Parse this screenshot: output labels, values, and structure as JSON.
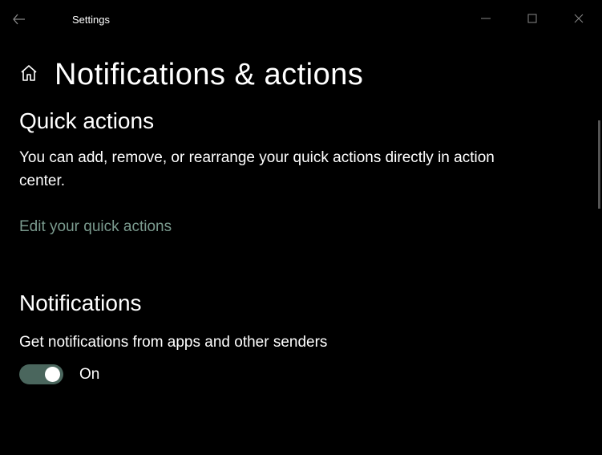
{
  "titlebar": {
    "title": "Settings"
  },
  "header": {
    "page_title": "Notifications & actions"
  },
  "quick_actions": {
    "heading": "Quick actions",
    "description": "You can add, remove, or rearrange your quick actions directly in action center.",
    "link_label": "Edit your quick actions"
  },
  "notifications": {
    "heading": "Notifications",
    "toggle_label": "Get notifications from apps and other senders",
    "toggle_on": true,
    "toggle_status": "On"
  },
  "colors": {
    "accent": "#4a665d",
    "link": "#7a9a8e"
  }
}
